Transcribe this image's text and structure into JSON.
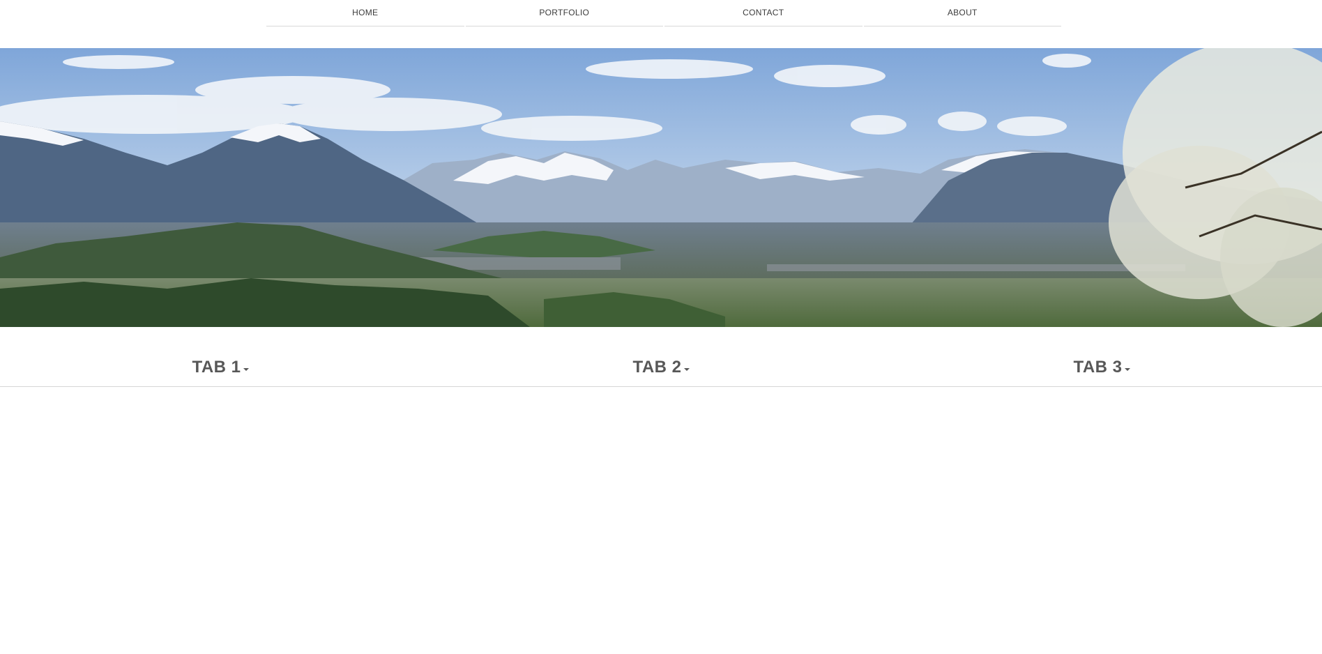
{
  "nav": {
    "items": [
      {
        "label": "HOME"
      },
      {
        "label": "PORTFOLIO"
      },
      {
        "label": "CONTACT"
      },
      {
        "label": "ABOUT"
      }
    ]
  },
  "hero": {
    "icon": "alpine-valley-panorama-image"
  },
  "tabs": [
    {
      "label": "TAB 1",
      "icon": "caret-down-icon"
    },
    {
      "label": "TAB 2",
      "icon": "caret-down-icon"
    },
    {
      "label": "TAB 3",
      "icon": "caret-down-icon"
    }
  ],
  "colors": {
    "nav_text": "#3b3b3b",
    "tab_text": "#575757",
    "divider": "#d6d6d6",
    "sky": "#8fb3df",
    "snow": "#f4f6fa"
  }
}
